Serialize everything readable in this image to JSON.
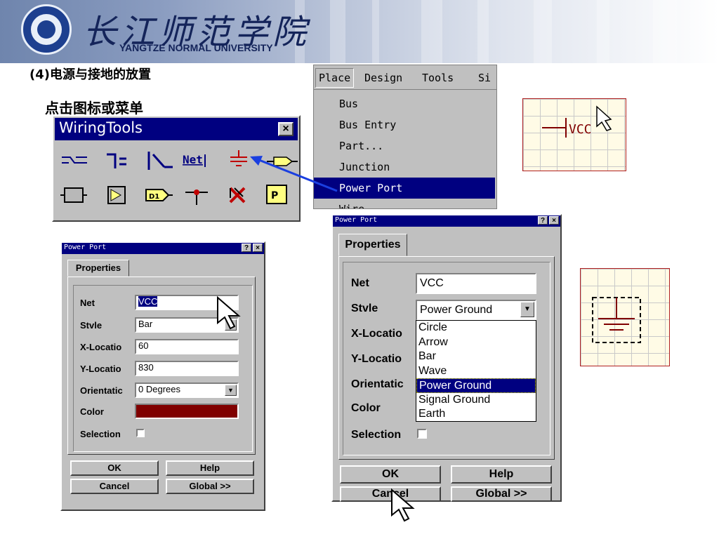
{
  "header": {
    "university_cn": "长江师范学院",
    "university_en": "YANGTZE NORMAL UNIVERSITY"
  },
  "slide": {
    "heading": "(4)电源与接地的放置",
    "subheading": "点击图标或菜单"
  },
  "wiring_tools": {
    "title": "WiringTools",
    "close": "×",
    "net_label": "Net",
    "d1_label": "D1",
    "p_label": "P"
  },
  "place_menu": {
    "bar": [
      "Place",
      "Design",
      "Tools",
      "Si"
    ],
    "items": [
      "Bus",
      "Bus Entry",
      "Part...",
      "Junction",
      "Power Port",
      "Wire"
    ],
    "selected": "Power Port"
  },
  "vcc_preview": {
    "label": "VCC"
  },
  "small_dialog": {
    "title": "Power Port",
    "help_btn": "?",
    "close_btn": "×",
    "tab": "Properties",
    "net_label": "Net",
    "net_value": "VCC",
    "style_label": "Stvle",
    "style_value": "Bar",
    "xloc_label": "X-Locatio",
    "xloc_value": "60",
    "yloc_label": "Y-Locatio",
    "yloc_value": "830",
    "orient_label": "Orientatic",
    "orient_value": "0 Degrees",
    "color_label": "Color",
    "color_value": "#800000",
    "selection_label": "Selection",
    "ok": "OK",
    "help": "Help",
    "cancel": "Cancel",
    "global": "Global >>"
  },
  "large_dialog": {
    "title": "Power Port",
    "help_btn": "?",
    "close_btn": "×",
    "tab": "Properties",
    "net_label": "Net",
    "net_value": "VCC",
    "style_label": "Stvle",
    "style_value": "Power Ground",
    "xloc_label": "X-Locatio",
    "yloc_label": "Y-Locatio",
    "orient_label": "Orientatic",
    "color_label": "Color",
    "selection_label": "Selection",
    "style_options": [
      "Circle",
      "Arrow",
      "Bar",
      "Wave",
      "Power Ground",
      "Signal Ground",
      "Earth"
    ],
    "selected_option": "Power Ground",
    "ok": "OK",
    "help": "Help",
    "cancel": "Cancel",
    "global": "Global >>"
  },
  "colors": {
    "titlebar": "#000080",
    "dialog_bg": "#c0c0c0",
    "wire_red": "#800000",
    "arrow_blue": "#1a3fe0",
    "grid_bg": "#fffbe6"
  }
}
